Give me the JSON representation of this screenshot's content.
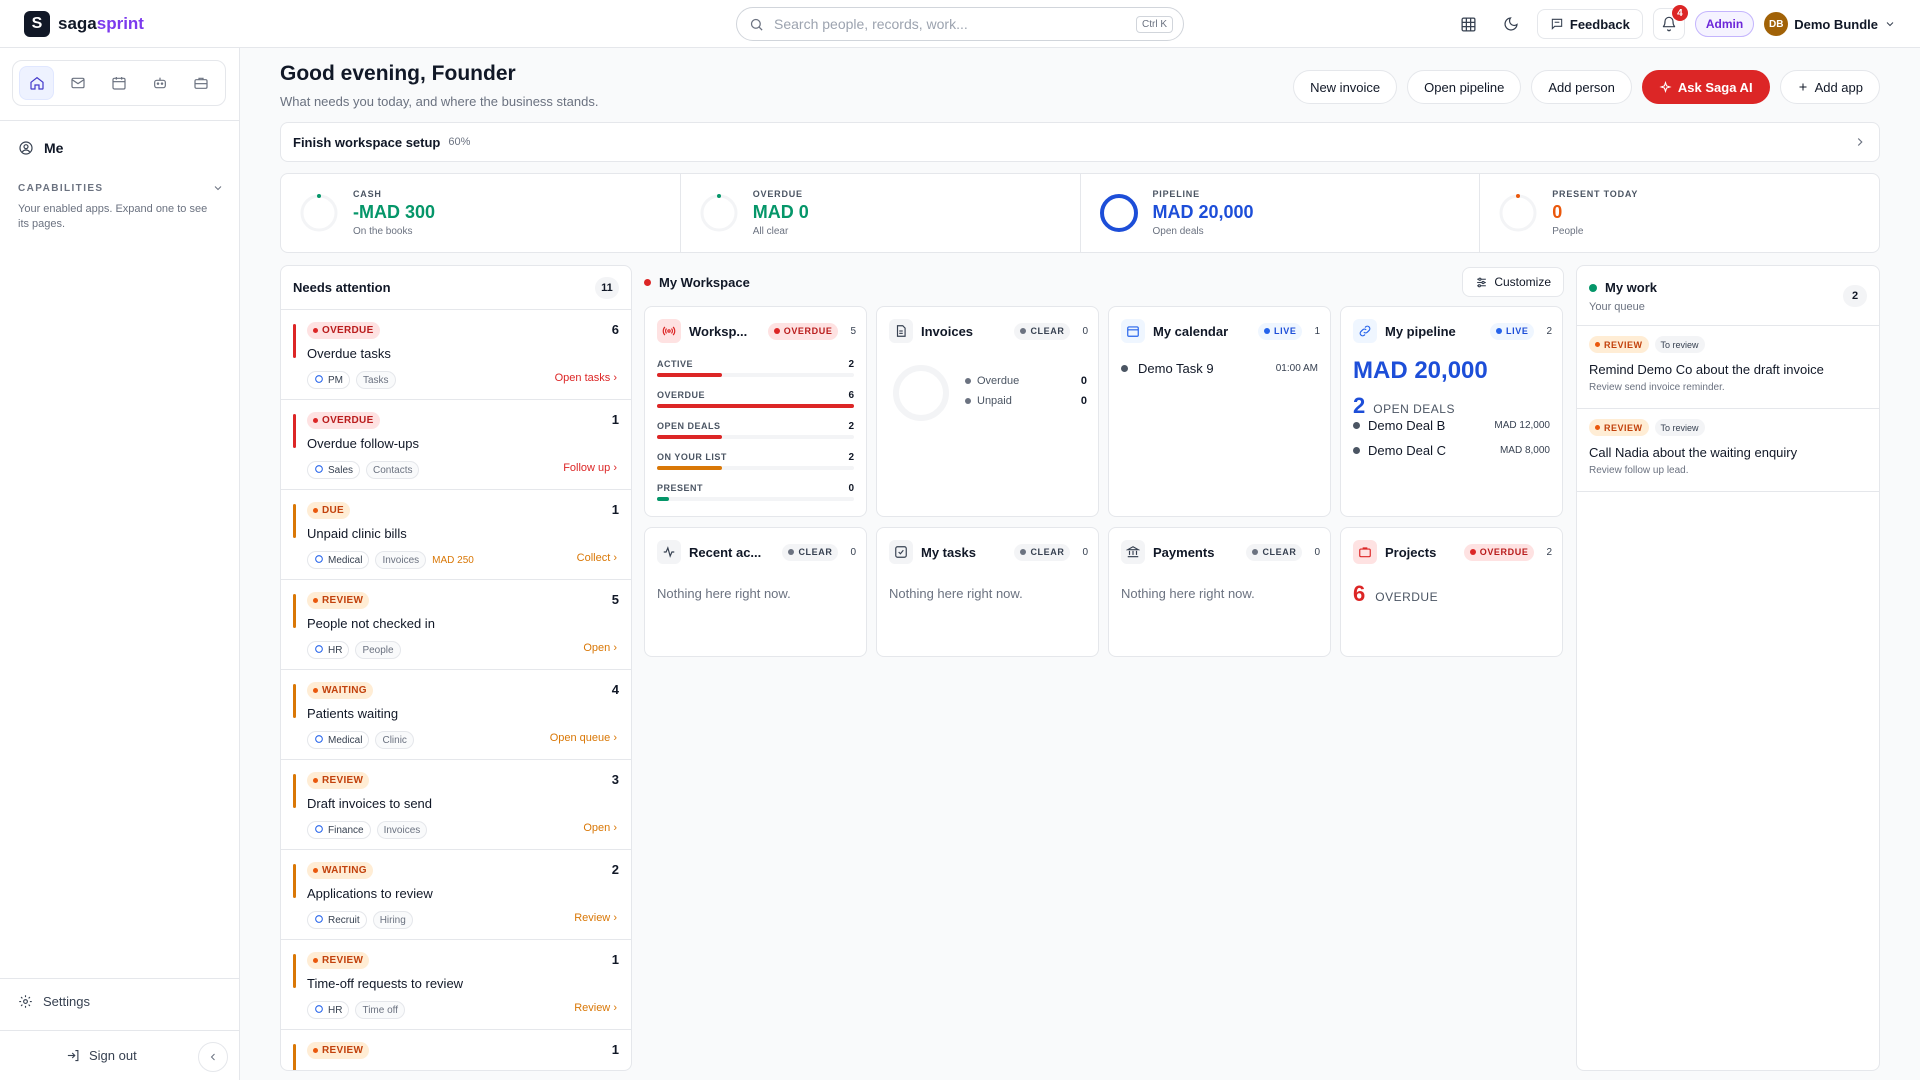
{
  "brand": {
    "name_main": "saga",
    "name_accent": "sprint",
    "mark": "S"
  },
  "search": {
    "placeholder": "Search people, records, work...",
    "shortcut": "Ctrl K"
  },
  "topbar": {
    "feedback_label": "Feedback",
    "notifications_count": "4",
    "role_badge": "Admin",
    "user_initials": "DB",
    "user_name": "Demo Bundle"
  },
  "sidebar": {
    "icons": [
      "home-icon",
      "mail-icon",
      "calendar-icon",
      "bot-icon",
      "briefcase-icon"
    ],
    "me_label": "Me",
    "capabilities_label": "CAPABILITIES",
    "capabilities_desc": "Your enabled apps. Expand one to see its pages.",
    "settings_label": "Settings",
    "signout_label": "Sign out"
  },
  "header": {
    "greeting": "Good evening, Founder",
    "subtitle": "What needs you today, and where the business stands.",
    "actions": {
      "new_invoice": "New invoice",
      "open_pipeline": "Open pipeline",
      "add_person": "Add person",
      "ask_ai": "Ask Saga AI",
      "add_app": "Add app"
    }
  },
  "setup": {
    "title": "Finish workspace setup",
    "percent": "60%"
  },
  "kpis": [
    {
      "label": "CASH",
      "value": "-MAD 300",
      "sub": "On the books",
      "color": "#059669"
    },
    {
      "label": "OVERDUE",
      "value": "MAD 0",
      "sub": "All clear",
      "color": "#059669"
    },
    {
      "label": "PIPELINE",
      "value": "MAD 20,000",
      "sub": "Open deals",
      "color": "#1d4ed8"
    },
    {
      "label": "PRESENT TODAY",
      "value": "0",
      "sub": "People",
      "color": "#ea580c"
    }
  ],
  "needs_attention": {
    "title": "Needs attention",
    "count": "11",
    "items": [
      {
        "tag": "OVERDUE",
        "count": "6",
        "name": "Overdue tasks",
        "chip": "PM",
        "chip_icon": "pm-icon",
        "chip2": "Tasks",
        "amount": "",
        "link": "Open tasks"
      },
      {
        "tag": "OVERDUE",
        "count": "1",
        "name": "Overdue follow-ups",
        "chip": "Sales",
        "chip_icon": "sales-icon",
        "chip2": "Contacts",
        "amount": "",
        "link": "Follow up"
      },
      {
        "tag": "DUE",
        "count": "1",
        "name": "Unpaid clinic bills",
        "chip": "Medical",
        "chip_icon": "medical-icon",
        "chip2": "Invoices",
        "amount": "MAD 250",
        "link": "Collect"
      },
      {
        "tag": "REVIEW",
        "count": "5",
        "name": "People not checked in",
        "chip": "HR",
        "chip_icon": "hr-icon",
        "chip2": "People",
        "amount": "",
        "link": "Open"
      },
      {
        "tag": "WAITING",
        "count": "4",
        "name": "Patients waiting",
        "chip": "Medical",
        "chip_icon": "medical-icon",
        "chip2": "Clinic",
        "amount": "",
        "link": "Open queue"
      },
      {
        "tag": "REVIEW",
        "count": "3",
        "name": "Draft invoices to send",
        "chip": "Finance",
        "chip_icon": "finance-icon",
        "chip2": "Invoices",
        "amount": "",
        "link": "Open"
      },
      {
        "tag": "WAITING",
        "count": "2",
        "name": "Applications to review",
        "chip": "Recruit",
        "chip_icon": "recruit-icon",
        "chip2": "Hiring",
        "amount": "",
        "link": "Review"
      },
      {
        "tag": "REVIEW",
        "count": "1",
        "name": "Time-off requests to review",
        "chip": "HR",
        "chip_icon": "hr-icon",
        "chip2": "Time off",
        "amount": "",
        "link": "Review"
      },
      {
        "tag": "REVIEW",
        "count": "1",
        "name": "",
        "chip": "",
        "chip_icon": "",
        "chip2": "",
        "amount": "",
        "link": ""
      }
    ]
  },
  "workspace": {
    "title": "My Workspace",
    "customize": "Customize",
    "workspace_card": {
      "title": "Worksp...",
      "status": "OVERDUE",
      "count": "5",
      "rows": [
        {
          "label": "ACTIVE",
          "value": "2",
          "fill": 0.33,
          "color": "#dc2626"
        },
        {
          "label": "OVERDUE",
          "value": "6",
          "fill": 1.0,
          "color": "#dc2626"
        },
        {
          "label": "OPEN DEALS",
          "value": "2",
          "fill": 0.33,
          "color": "#dc2626"
        },
        {
          "label": "ON YOUR LIST",
          "value": "2",
          "fill": 0.33,
          "color": "#d97706"
        },
        {
          "label": "PRESENT",
          "value": "0",
          "fill": 0.06,
          "color": "#059669"
        }
      ]
    },
    "invoices": {
      "title": "Invoices",
      "status": "CLEAR",
      "count": "0",
      "legend": [
        {
          "label": "Overdue",
          "value": "0"
        },
        {
          "label": "Unpaid",
          "value": "0"
        }
      ]
    },
    "calendar": {
      "title": "My calendar",
      "status": "LIVE",
      "count": "1",
      "event": "Demo Task 9",
      "time": "01:00 AM"
    },
    "pipeline": {
      "title": "My pipeline",
      "status": "LIVE",
      "count": "2",
      "total": "MAD 20,000",
      "deals_count": "2",
      "deals_label": "OPEN DEALS",
      "deals": [
        {
          "name": "Demo Deal B",
          "amount": "MAD 12,000"
        },
        {
          "name": "Demo Deal C",
          "amount": "MAD 8,000"
        }
      ]
    },
    "recent": {
      "title": "Recent ac...",
      "status": "CLEAR",
      "count": "0",
      "empty": "Nothing here right now."
    },
    "tasks": {
      "title": "My tasks",
      "status": "CLEAR",
      "count": "0",
      "empty": "Nothing here right now."
    },
    "payments": {
      "title": "Payments",
      "status": "CLEAR",
      "count": "0",
      "empty": "Nothing here right now."
    },
    "projects": {
      "title": "Projects",
      "status": "OVERDUE",
      "count": "2",
      "big": "6",
      "big_label": "OVERDUE"
    }
  },
  "my_work": {
    "title": "My work",
    "subtitle": "Your queue",
    "count": "2",
    "items": [
      {
        "tag": "REVIEW",
        "sub": "To review",
        "title": "Remind Demo Co about the draft invoice",
        "desc": "Review send invoice reminder."
      },
      {
        "tag": "REVIEW",
        "sub": "To review",
        "title": "Call Nadia about the waiting enquiry",
        "desc": "Review follow up lead."
      }
    ]
  }
}
